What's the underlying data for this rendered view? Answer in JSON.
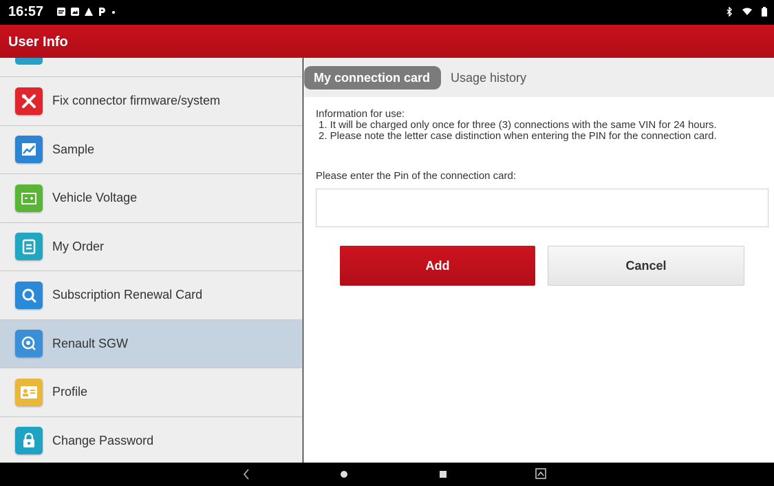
{
  "status_bar": {
    "time": "16:57",
    "notification_icons": [
      "message-icon",
      "gallery-icon",
      "warning-icon",
      "parking-icon",
      "dot-icon"
    ],
    "system_icons": [
      "bluetooth-icon",
      "wifi-icon",
      "battery-icon"
    ]
  },
  "title_bar": {
    "title": "User Info"
  },
  "sidebar": {
    "items": [
      {
        "label": "Fix connector firmware/system",
        "icon": "tools-icon",
        "color": "#e0252d"
      },
      {
        "label": "Sample",
        "icon": "chart-icon",
        "color": "#2d84d2"
      },
      {
        "label": "Vehicle Voltage",
        "icon": "battery-icon",
        "color": "#59b536"
      },
      {
        "label": "My Order",
        "icon": "clipboard-icon",
        "color": "#21a7c2"
      },
      {
        "label": "Subscription Renewal Card",
        "icon": "search-icon",
        "color": "#2a8ad8"
      },
      {
        "label": "Renault SGW",
        "icon": "gateway-icon",
        "color": "#3a8fd6",
        "selected": true
      },
      {
        "label": "Profile",
        "icon": "id-card-icon",
        "color": "#e9b83a"
      },
      {
        "label": "Change Password",
        "icon": "lock-icon",
        "color": "#1fa3c4"
      }
    ]
  },
  "tabs": [
    {
      "label": "My connection card",
      "active": true
    },
    {
      "label": "Usage history",
      "active": false
    }
  ],
  "info": {
    "heading": "Information for use:",
    "line1": "1. It will be charged only once for three (3) connections with the same VIN for 24 hours.",
    "line2": "2. Please note the letter case distinction when entering the PIN for the connection card."
  },
  "pin": {
    "label": "Please enter the Pin of the connection card:",
    "value": "",
    "placeholder": ""
  },
  "buttons": {
    "add": "Add",
    "cancel": "Cancel"
  },
  "colors": {
    "brand_red": "#c8111d",
    "selected_row": "#c5d3e1",
    "active_tab": "#7b7b7b"
  },
  "nav_bar": {
    "icons": [
      "back-icon",
      "home-icon",
      "recents-icon",
      "screenshot-icon"
    ]
  }
}
